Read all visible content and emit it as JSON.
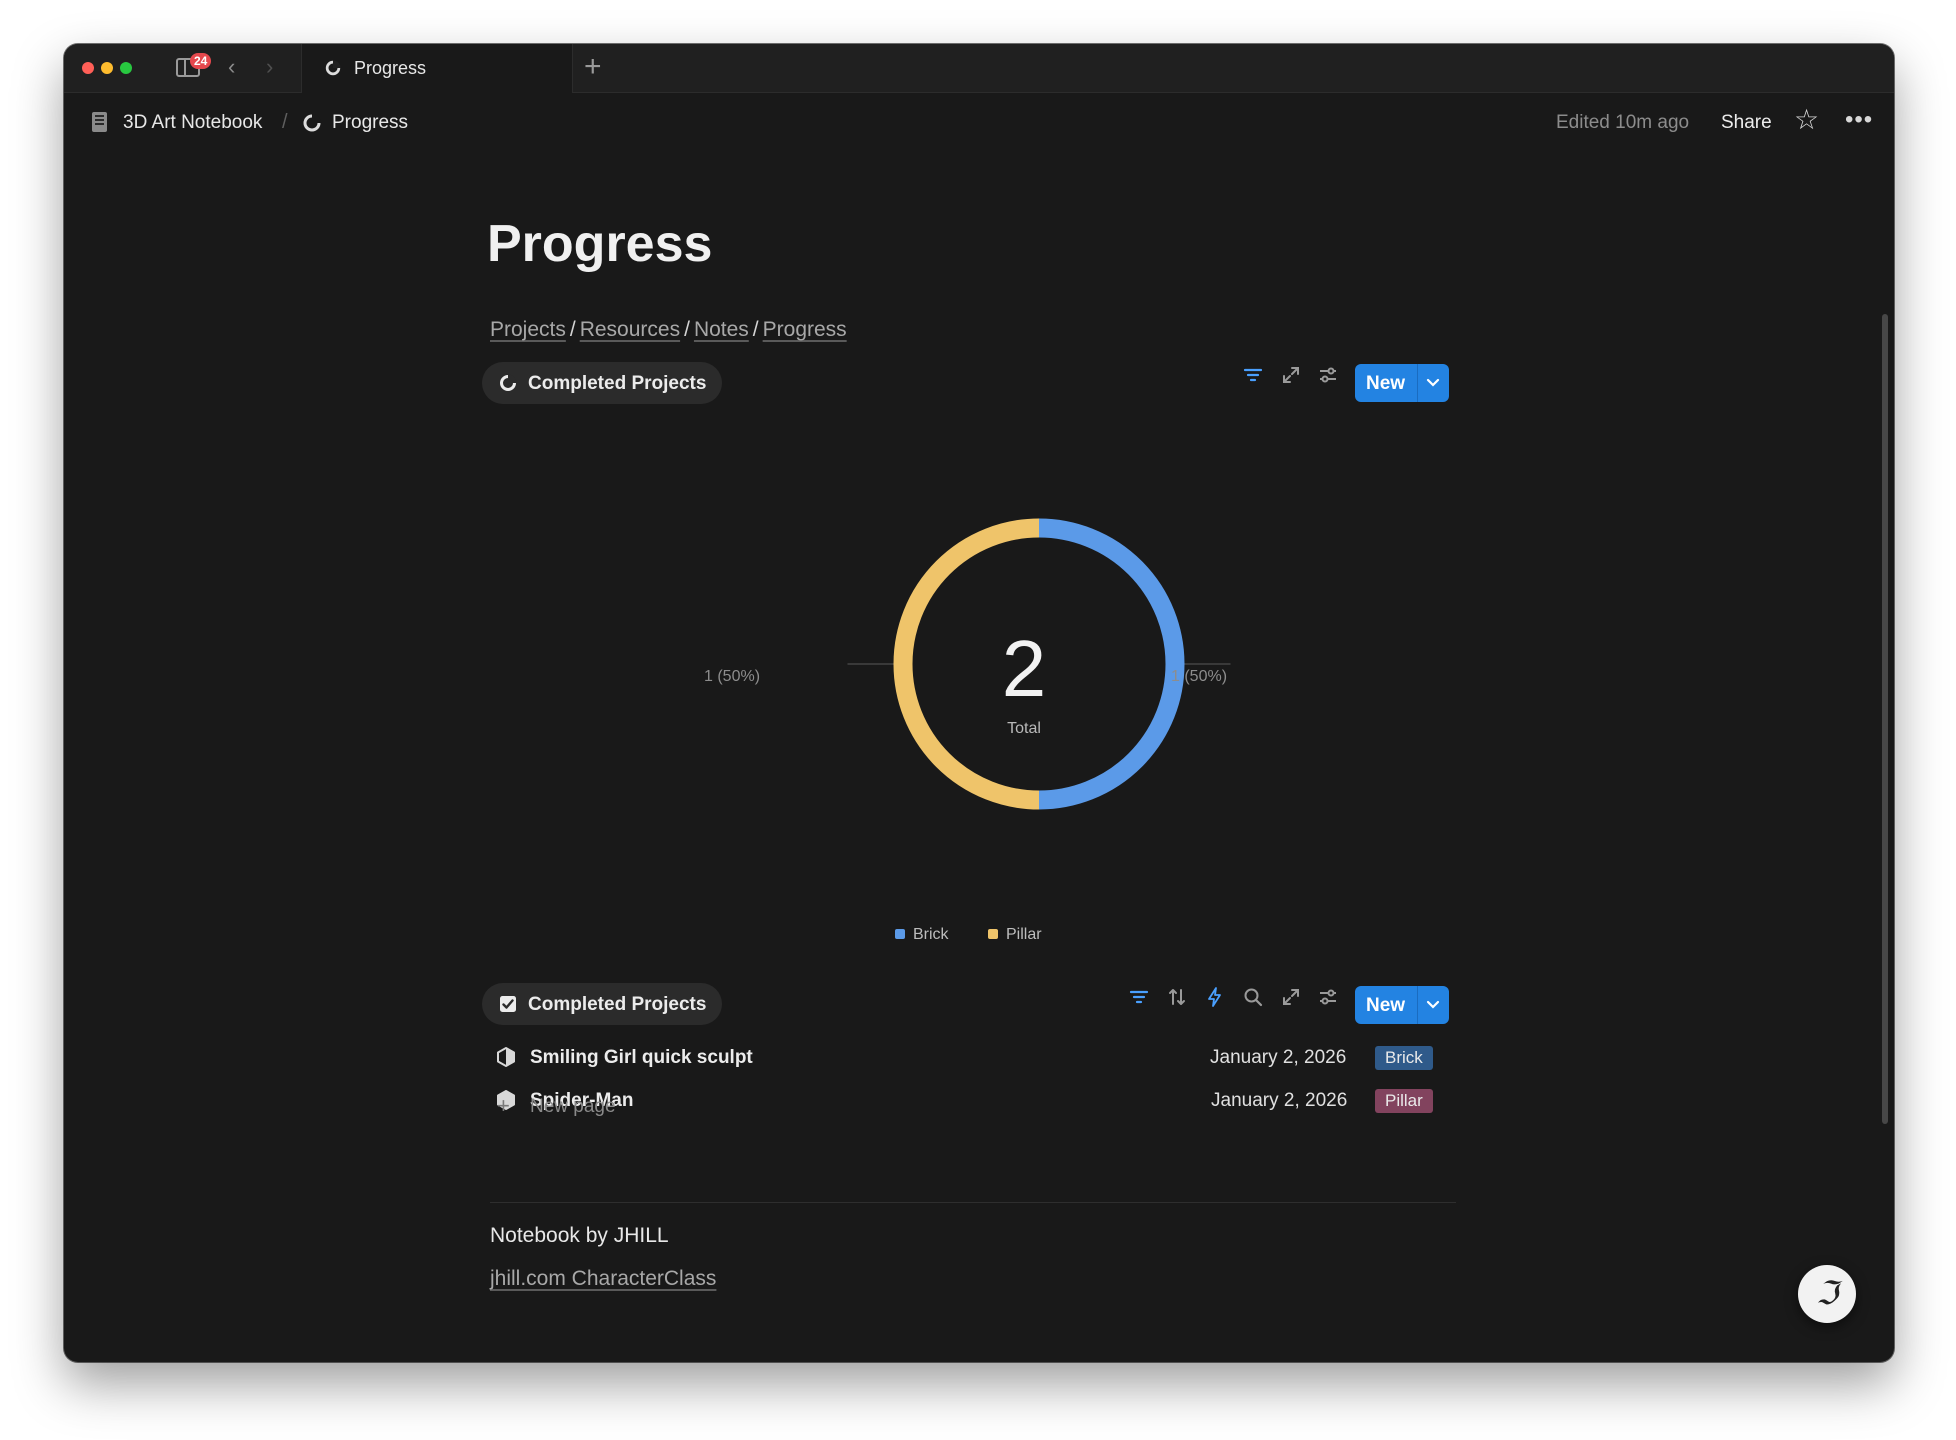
{
  "window": {
    "notification_count": "24"
  },
  "tab": {
    "title": "Progress",
    "icon": "pie-chart-icon"
  },
  "breadcrumb": {
    "workspace": "3D Art Notebook",
    "separator": "/",
    "page": "Progress"
  },
  "topbar": {
    "edited": "Edited 10m ago",
    "share": "Share"
  },
  "page": {
    "title": "Progress",
    "links": [
      "Projects",
      "Resources",
      "Notes",
      "Progress"
    ],
    "link_separator": "/"
  },
  "chart_view": {
    "name": "Completed Projects",
    "icon": "pie-chart-icon",
    "new_label": "New",
    "tools": [
      "filter-icon",
      "expand-icon",
      "settings-icon"
    ]
  },
  "chart_data": {
    "type": "pie",
    "categories": [
      "Brick",
      "Pillar"
    ],
    "values": [
      1,
      1
    ],
    "labels": [
      "1 (50%)",
      "1 (50%)"
    ],
    "colors": [
      "#5b9ae8",
      "#efc46a"
    ],
    "center_value": "2",
    "center_label": "Total",
    "legend_position": "bottom"
  },
  "list_view": {
    "name": "Completed Projects",
    "icon": "checkbox-icon",
    "new_label": "New",
    "tools": [
      "filter-icon",
      "sort-icon",
      "automation-icon",
      "search-icon",
      "expand-icon",
      "settings-icon"
    ],
    "rows": [
      {
        "title": "Smiling Girl quick sculpt",
        "date": "January 2, 2026",
        "tag": "Brick",
        "tag_color": "#2f5a8a",
        "icon": "half-cube-icon"
      },
      {
        "title": "Spider-Man",
        "date": "January 2, 2026",
        "tag": "Pillar",
        "tag_color": "#82435e",
        "icon": "cube-icon"
      }
    ],
    "new_page_label": "New page"
  },
  "footer": {
    "line1": "Notebook by JHILL",
    "line2": "jhill.com CharacterClass"
  },
  "colors": {
    "accent": "#2383e2",
    "background": "#191919"
  }
}
